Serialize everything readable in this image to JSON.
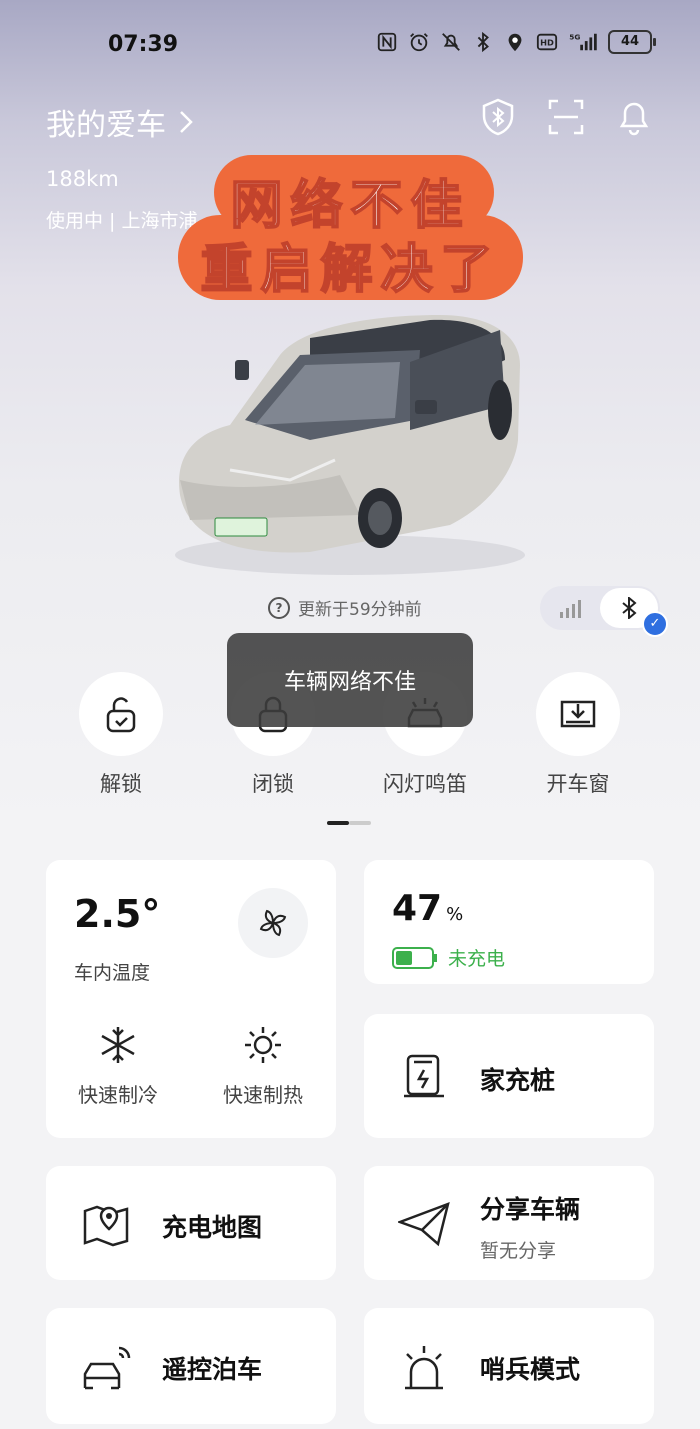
{
  "status_bar": {
    "time": "07:39",
    "battery": "44"
  },
  "header": {
    "title": "我的爱车",
    "range": "188km",
    "usage": "使用中 | 上海市浦"
  },
  "overlay": {
    "line1": "网络不佳",
    "line2": "重启解决了"
  },
  "update": {
    "text": "更新于59分钟前"
  },
  "toast": {
    "text": "车辆网络不佳"
  },
  "controls": [
    {
      "label": "解锁",
      "icon": "unlock-icon"
    },
    {
      "label": "闭锁",
      "icon": "lock-icon"
    },
    {
      "label": "闪灯鸣笛",
      "icon": "car-horn-icon"
    },
    {
      "label": "开车窗",
      "icon": "window-icon"
    }
  ],
  "climate": {
    "temp": "2.5°",
    "temp_label": "车内温度",
    "cool": "快速制冷",
    "heat": "快速制热"
  },
  "battery": {
    "percent": "47",
    "unit": "%",
    "status": "未充电",
    "level": 0.47,
    "color": "#3cb04c"
  },
  "tiles": {
    "home_charger": "家充桩",
    "charging_map": "充电地图",
    "share": "分享车辆",
    "share_sub": "暂无分享",
    "remote_parking": "遥控泊车",
    "sentry": "哨兵模式"
  },
  "colors": {
    "accent": "#2f6fe0",
    "banner": "#ef6a3b",
    "charge_green": "#3cb04c"
  }
}
